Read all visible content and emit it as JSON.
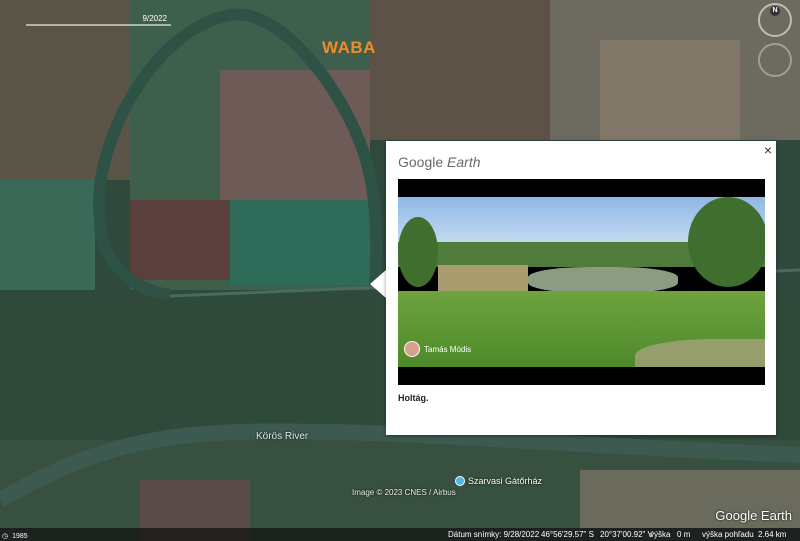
{
  "map": {
    "label_waba": "WABA",
    "river_label": "Körös River",
    "poi_label": "Szarvasi Gátőrház",
    "credit": "Image © 2023 CNES / Airbus",
    "time_slider_label": "9/2022",
    "compass_label": "N"
  },
  "popup": {
    "logo_text_a": "Google",
    "logo_text_b": "Earth",
    "close_label": "×",
    "photo_author": "Tamás Módis",
    "description": "Holtág."
  },
  "status": {
    "year": "1985",
    "date": "Dátum snímky: 9/28/2022",
    "lat": "46°56'29.57\" S",
    "lon": "20°37'00.92\" V",
    "elev": "výška",
    "elev_value": "0 m",
    "view_height_label": "výška pohľadu",
    "view_height": "2.64 km"
  },
  "logo": "Google Earth",
  "colors": {
    "accent": "#f08a2a",
    "poi": "#4db6e8"
  }
}
